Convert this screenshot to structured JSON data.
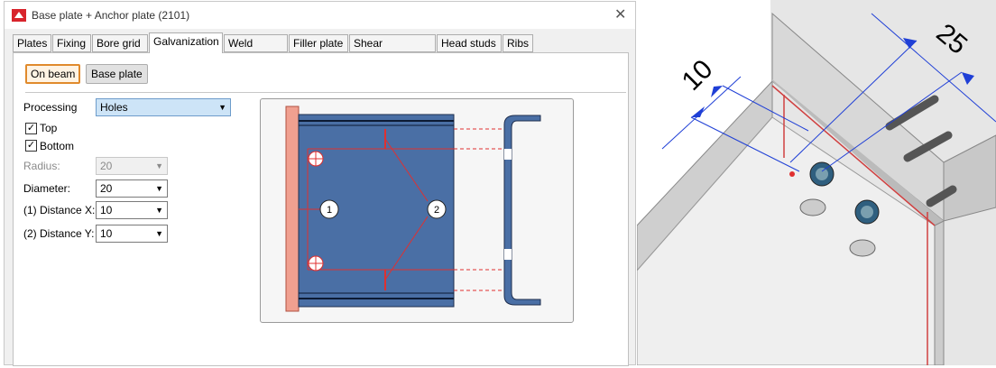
{
  "window": {
    "title": "Base plate + Anchor plate (2101)",
    "close_glyph": "✕"
  },
  "tabs": [
    "Plates",
    "Fixing",
    "Bore grid",
    "Galvanization",
    "Weld seams",
    "Filler plate",
    "Shear connector",
    "Head studs",
    "Ribs"
  ],
  "active_tab": "Galvanization",
  "mode_buttons": {
    "on_beam": "On beam",
    "base_plate": "Base plate",
    "selected": "On beam"
  },
  "form": {
    "processing_label": "Processing",
    "processing_value": "Holes",
    "top_label": "Top",
    "top_checked": true,
    "bottom_label": "Bottom",
    "bottom_checked": true,
    "radius_label": "Radius:",
    "radius_value": "20",
    "diameter_label": "Diameter:",
    "diameter_value": "20",
    "distance_x_label": "(1) Distance X:",
    "distance_x_value": "10",
    "distance_y_label": "(2) Distance Y:",
    "distance_y_value": "10"
  },
  "diagram": {
    "marker1": "1",
    "marker2": "2"
  },
  "view3d": {
    "dim_left": "10",
    "dim_right": "25"
  },
  "colors": {
    "accent": "#e08a2c",
    "plate_blue": "#4a6fa5",
    "weld_red": "#e03030",
    "plate_salmon": "#f0a090",
    "dim_blue": "#1f3fd6"
  }
}
